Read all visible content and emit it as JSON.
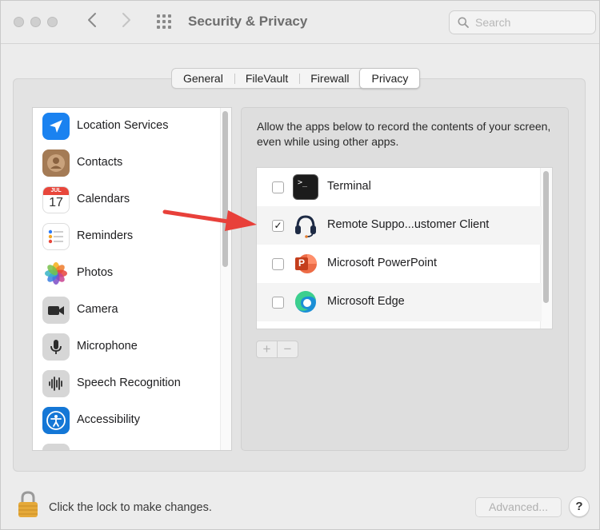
{
  "window": {
    "title": "Security & Privacy",
    "search_placeholder": "Search"
  },
  "tabs": [
    {
      "label": "General",
      "active": false
    },
    {
      "label": "FileVault",
      "active": false
    },
    {
      "label": "Firewall",
      "active": false
    },
    {
      "label": "Privacy",
      "active": true
    }
  ],
  "sidebar": {
    "items": [
      {
        "label": "Location Services",
        "icon": "location-arrow-icon"
      },
      {
        "label": "Contacts",
        "icon": "contacts-icon"
      },
      {
        "label": "Calendars",
        "icon": "calendar-icon",
        "icon_month": "JUL",
        "icon_day": "17"
      },
      {
        "label": "Reminders",
        "icon": "reminders-icon"
      },
      {
        "label": "Photos",
        "icon": "photos-icon"
      },
      {
        "label": "Camera",
        "icon": "camera-icon"
      },
      {
        "label": "Microphone",
        "icon": "microphone-icon"
      },
      {
        "label": "Speech Recognition",
        "icon": "waveform-icon"
      },
      {
        "label": "Accessibility",
        "icon": "accessibility-icon"
      }
    ]
  },
  "content": {
    "description": "Allow the apps below to record the contents of your screen, even while using other apps.",
    "apps": [
      {
        "label": "Terminal",
        "checked": false,
        "icon": "terminal-icon",
        "icon_text": ">_"
      },
      {
        "label": "Remote Suppo...ustomer Client",
        "checked": true,
        "icon": "headset-icon"
      },
      {
        "label": "Microsoft PowerPoint",
        "checked": false,
        "icon": "powerpoint-icon",
        "icon_text": "P"
      },
      {
        "label": "Microsoft Edge",
        "checked": false,
        "icon": "edge-icon"
      }
    ],
    "add_label": "+",
    "remove_label": "−"
  },
  "footer": {
    "lock_text": "Click the lock to make changes.",
    "advanced_label": "Advanced...",
    "help_label": "?"
  },
  "colors": {
    "annotation_arrow": "#e8403a",
    "location_blue": "#1a82f0",
    "accessibility_blue": "#1477d6",
    "contacts_brown": "#a47b55",
    "lock_gold": "#e5a93a",
    "powerpoint_orange": "#d3502c"
  }
}
